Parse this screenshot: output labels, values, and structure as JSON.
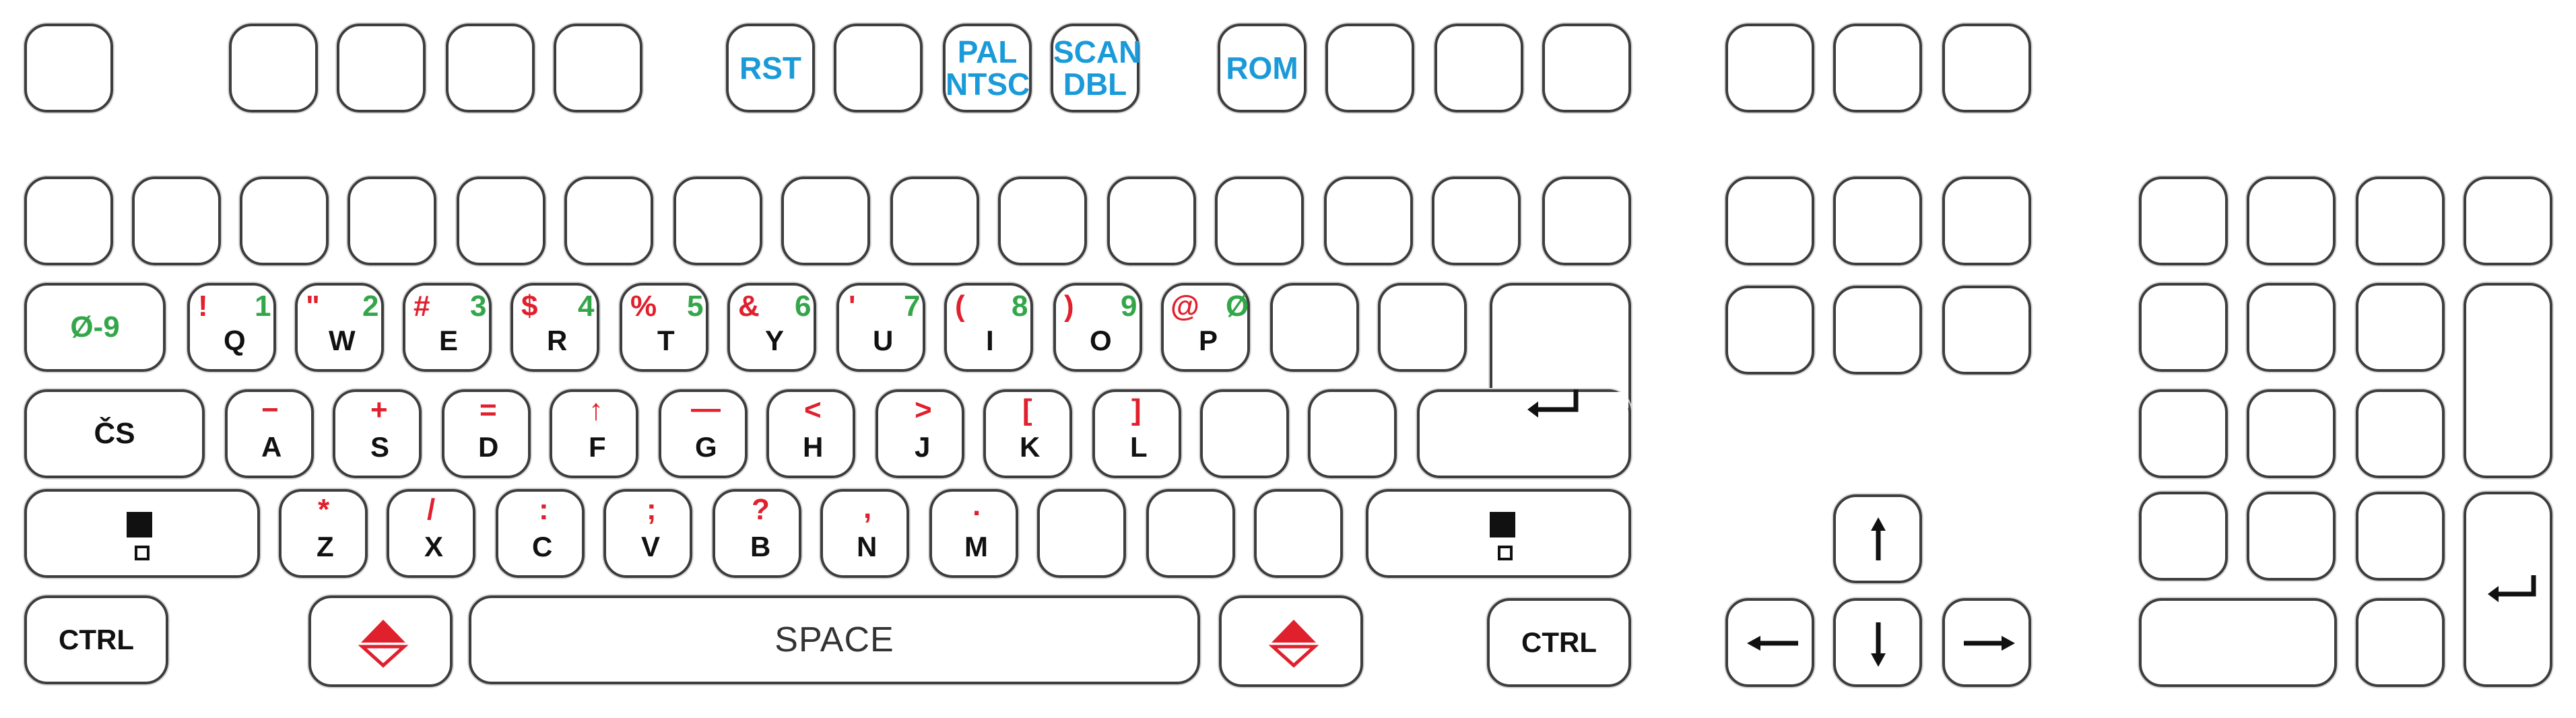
{
  "colors": {
    "shift_red": "#e0202c",
    "number_green": "#34a64a",
    "function_blue": "#1a9ad8",
    "key_outline": "#3d3d3d"
  },
  "function_row": {
    "rst": "RST",
    "pal": "PAL",
    "ntsc": "NTSC",
    "scan": "SCAN",
    "dbl": "DBL",
    "rom": "ROM"
  },
  "qrow": [
    {
      "letter": "Q",
      "sym": "!",
      "num": "1"
    },
    {
      "letter": "W",
      "sym": "\"",
      "num": "2"
    },
    {
      "letter": "E",
      "sym": "#",
      "num": "3"
    },
    {
      "letter": "R",
      "sym": "$",
      "num": "4"
    },
    {
      "letter": "T",
      "sym": "%",
      "num": "5"
    },
    {
      "letter": "Y",
      "sym": "&",
      "num": "6"
    },
    {
      "letter": "U",
      "sym": "'",
      "num": "7"
    },
    {
      "letter": "I",
      "sym": "(",
      "num": "8"
    },
    {
      "letter": "O",
      "sym": ")",
      "num": "9"
    },
    {
      "letter": "P",
      "sym": "@",
      "num": "Ø"
    }
  ],
  "arow": [
    {
      "letter": "A",
      "sym": "−"
    },
    {
      "letter": "S",
      "sym": "+"
    },
    {
      "letter": "D",
      "sym": "="
    },
    {
      "letter": "F",
      "sym": "↑"
    },
    {
      "letter": "G",
      "sym": "—"
    },
    {
      "letter": "H",
      "sym": "<"
    },
    {
      "letter": "J",
      "sym": ">"
    },
    {
      "letter": "K",
      "sym": "["
    },
    {
      "letter": "L",
      "sym": "]"
    }
  ],
  "zrow": [
    {
      "letter": "Z",
      "sym": "*"
    },
    {
      "letter": "X",
      "sym": "/"
    },
    {
      "letter": "C",
      "sym": ":"
    },
    {
      "letter": "V",
      "sym": ";"
    },
    {
      "letter": "B",
      "sym": "?"
    },
    {
      "letter": "N",
      "sym": ","
    },
    {
      "letter": "M",
      "sym": "."
    }
  ],
  "numlock_label": "Ø-9",
  "caps_label": "ČS",
  "space_label": "SPACE",
  "ctrl_left_label": "CTRL",
  "ctrl_right_label": "CTRL"
}
